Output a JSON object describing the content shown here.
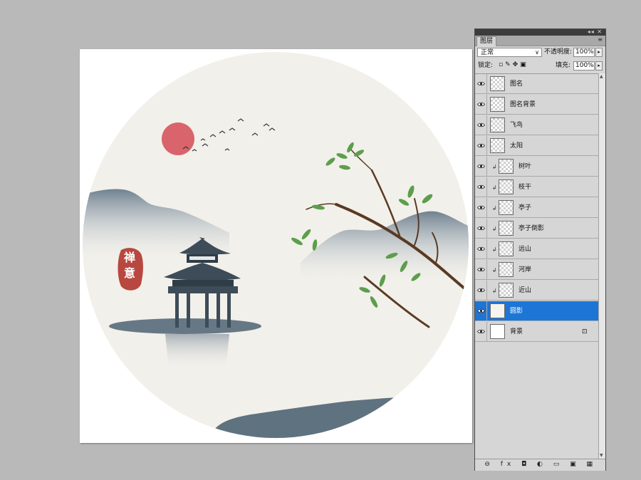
{
  "panel": {
    "tab_label": "图层",
    "window_controls": "◂◂ ✕",
    "menu_icon": "≡",
    "blend_mode": "正常",
    "opacity_label": "不透明度:",
    "opacity_value": "100%",
    "lock_label": "锁定:",
    "fill_label": "填充:",
    "fill_value": "100%",
    "bottom_icons": "⊖ fx ◘ ◐ ▭ ▣ ▦"
  },
  "artwork": {
    "seal_chars": [
      "禅",
      "意"
    ],
    "colors": {
      "paper": "#f2f0ea",
      "sun": "#d9646b",
      "mountain": "#7d8d9b",
      "ink": "#3d4c58",
      "seal": "#b8483f",
      "leaf": "#5d9e4c",
      "branch": "#5a3a24"
    }
  },
  "layers": [
    {
      "name": "图名",
      "thumb": "checker",
      "clipped": false,
      "selected": false,
      "locked": false
    },
    {
      "name": "图名背景",
      "thumb": "checker",
      "clipped": false,
      "selected": false,
      "locked": false
    },
    {
      "name": "飞鸟",
      "thumb": "checker",
      "clipped": false,
      "selected": false,
      "locked": false
    },
    {
      "name": "太阳",
      "thumb": "checker",
      "clipped": false,
      "selected": false,
      "locked": false
    },
    {
      "name": "树叶",
      "thumb": "checker",
      "clipped": true,
      "selected": false,
      "locked": false
    },
    {
      "name": "枝干",
      "thumb": "checker",
      "clipped": true,
      "selected": false,
      "locked": false
    },
    {
      "name": "亭子",
      "thumb": "checker",
      "clipped": true,
      "selected": false,
      "locked": false
    },
    {
      "name": "亭子倒影",
      "thumb": "checker",
      "clipped": true,
      "selected": false,
      "locked": false
    },
    {
      "name": "远山",
      "thumb": "checker",
      "clipped": true,
      "selected": false,
      "locked": false
    },
    {
      "name": "河岸",
      "thumb": "checker",
      "clipped": true,
      "selected": false,
      "locked": false
    },
    {
      "name": "近山",
      "thumb": "checker",
      "clipped": true,
      "selected": false,
      "locked": false
    },
    {
      "name": "圆影",
      "thumb": "solid",
      "clipped": false,
      "selected": true,
      "locked": false
    },
    {
      "name": "背景",
      "thumb": "white",
      "clipped": false,
      "selected": false,
      "locked": true
    }
  ]
}
